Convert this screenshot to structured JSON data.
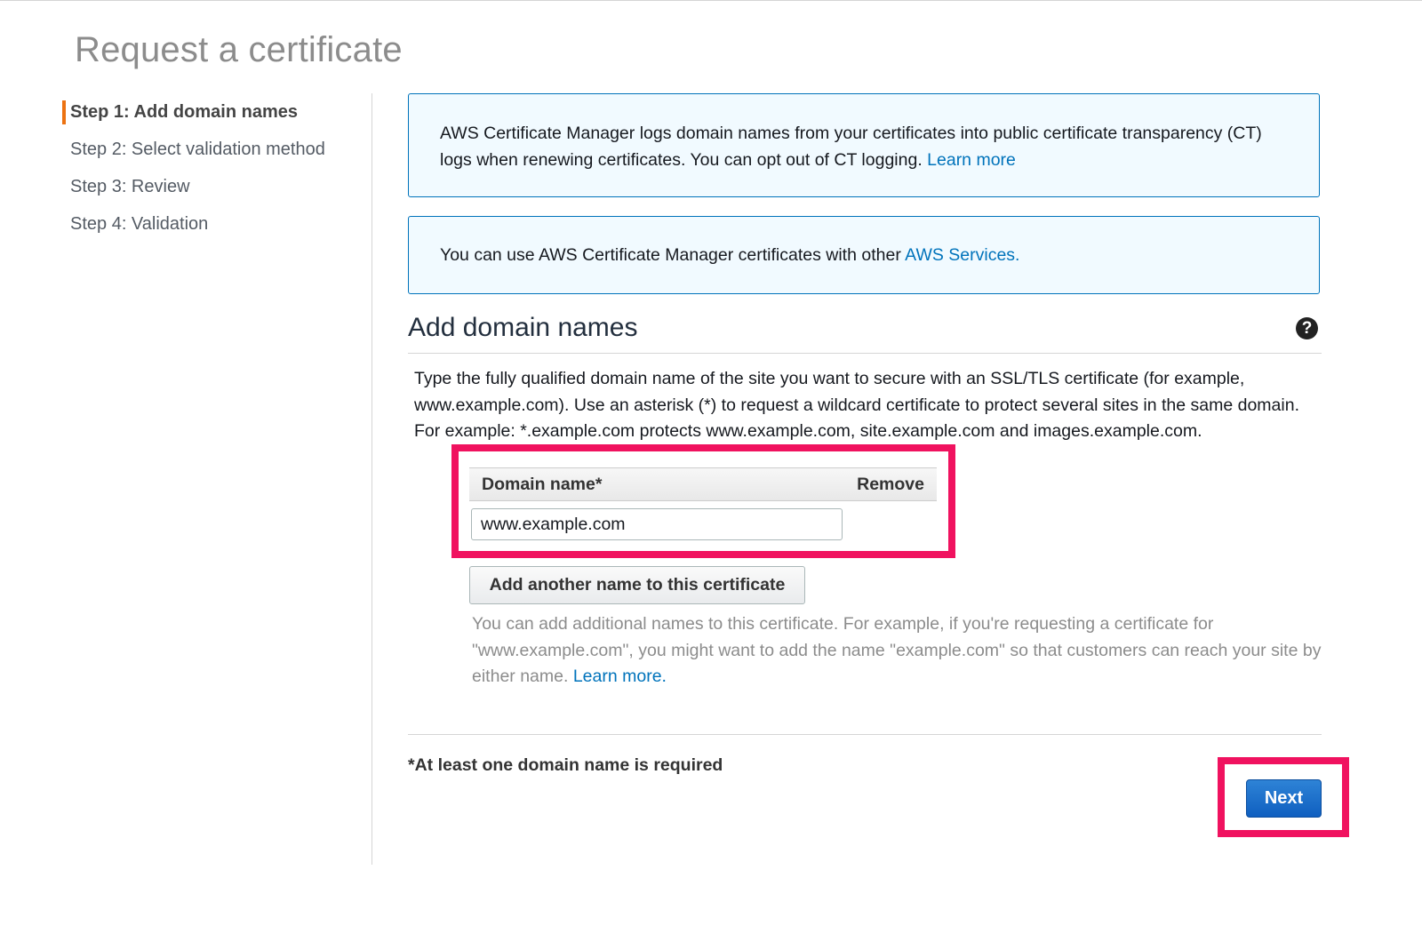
{
  "page": {
    "title": "Request a certificate"
  },
  "steps": [
    {
      "label": "Step 1: Add domain names"
    },
    {
      "label": "Step 2: Select validation method"
    },
    {
      "label": "Step 3: Review"
    },
    {
      "label": "Step 4: Validation"
    }
  ],
  "info": {
    "ct_text": "AWS Certificate Manager logs domain names from your certificates into public certificate transparency (CT) logs when renewing certificates. You can opt out of CT logging.",
    "ct_link": "Learn more",
    "services_text": "You can use AWS Certificate Manager certificates with other",
    "services_link": "AWS Services."
  },
  "section": {
    "title": "Add domain names",
    "help_glyph": "?",
    "description": "Type the fully qualified domain name of the site you want to secure with an SSL/TLS certificate (for example, www.example.com). Use an asterisk (*) to request a wildcard certificate to protect several sites in the same domain. For example: *.example.com protects www.example.com, site.example.com and images.example.com."
  },
  "table": {
    "col_domain": "Domain name*",
    "col_remove": "Remove",
    "domain_value": "www.example.com"
  },
  "add_button": {
    "label": "Add another name to this certificate"
  },
  "hint": {
    "text": "You can add additional names to this certificate. For example, if you're requesting a certificate for \"www.example.com\", you might want to add the name \"example.com\" so that customers can reach your site by either name.",
    "link": "Learn more."
  },
  "footer": {
    "required_note": "*At least one domain name is required",
    "next_label": "Next"
  },
  "colors": {
    "accent": "#ec7211",
    "link": "#0073bb",
    "highlight": "#f0125f",
    "primary_button": "#0f5fc0",
    "info_background": "#f1faff"
  }
}
